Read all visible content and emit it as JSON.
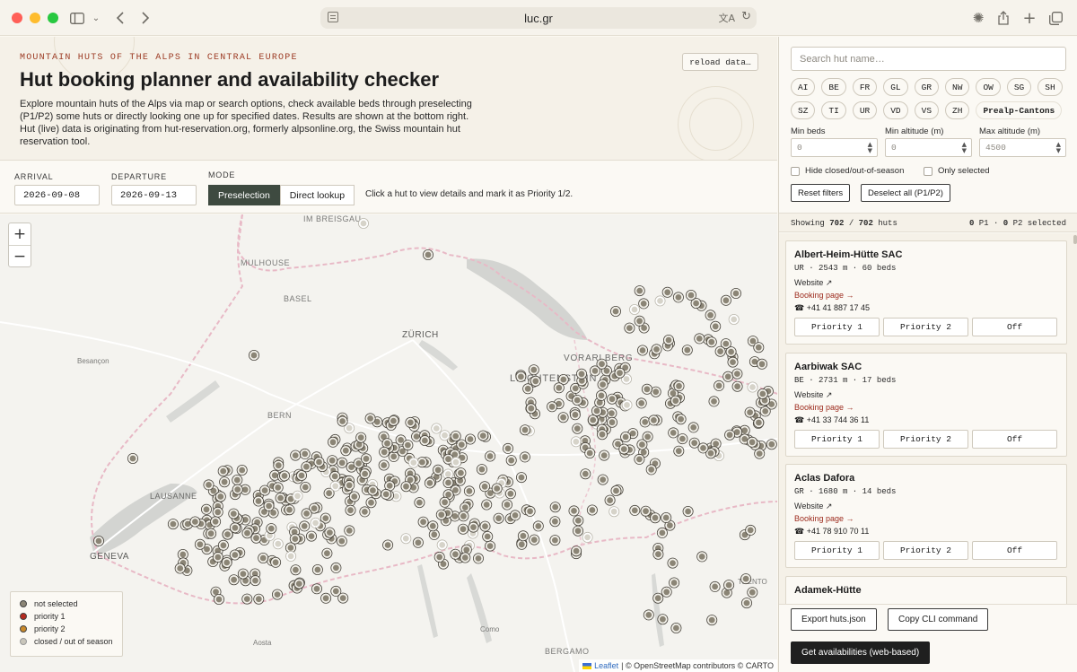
{
  "browser": {
    "url": "luc.gr",
    "icons": [
      "sidebar-toggle-icon",
      "chevron-down-icon",
      "back-icon",
      "forward-icon",
      "page-settings-icon",
      "translate-icon",
      "reload-icon",
      "extensions-icon",
      "share-icon",
      "new-tab-icon",
      "tab-overview-icon"
    ]
  },
  "header": {
    "kicker": "MOUNTAIN HUTS OF THE ALPS IN CENTRAL EUROPE",
    "title": "Hut booking planner and availability checker",
    "description": "Explore mountain huts of the Alps via map or search options, check available beds through preselecting (P1/P2) some huts or directly looking one up for specified dates. Results are shown at the bottom right. Hut (live) data is originating from hut-reservation.org, formerly alpsonline.org, the Swiss mountain hut reservation tool.",
    "reload_label": "reload data…"
  },
  "controls": {
    "arrival_label": "ARRIVAL",
    "arrival_value": "2026-09-08",
    "departure_label": "DEPARTURE",
    "departure_value": "2026-09-13",
    "mode_label": "MODE",
    "mode_preselection": "Preselection",
    "mode_direct": "Direct lookup",
    "hint": "Click a hut to view details and mark it as Priority 1/2."
  },
  "map": {
    "zoom_in": "+",
    "zoom_out": "−",
    "places": [
      "IM BREISGAU",
      "MULHOUSE",
      "BASEL",
      "ZÜRICH",
      "Besançon",
      "VORARLBERG",
      "LIECHTENSTEIN",
      "BERN",
      "LAUSANNE",
      "GENEVA",
      "Aosta",
      "Como",
      "BERGAMO",
      "TRENTO"
    ],
    "legend": [
      {
        "label": "not selected",
        "color": "#8b8576"
      },
      {
        "label": "priority 1",
        "color": "#b52a1f"
      },
      {
        "label": "priority 2",
        "color": "#c9892a"
      },
      {
        "label": "closed / out of season",
        "color": "#c9c6bb"
      }
    ],
    "attribution_leaflet": "Leaflet",
    "attribution_rest": "| © OpenStreetMap contributors © CARTO"
  },
  "sidebar": {
    "search_placeholder": "Search hut name…",
    "cantons": [
      "AI",
      "BE",
      "FR",
      "GL",
      "GR",
      "NW",
      "OW",
      "SG",
      "SH",
      "SZ",
      "TI",
      "UR",
      "VD",
      "VS",
      "ZH",
      "Prealp-Cantons"
    ],
    "min_beds_label": "Min beds",
    "min_beds_value": "0",
    "min_alt_label": "Min altitude (m)",
    "min_alt_value": "0",
    "max_alt_label": "Max altitude (m)",
    "max_alt_value": "4500",
    "hide_closed_label": "Hide closed/out-of-season",
    "only_selected_label": "Only selected",
    "reset_label": "Reset filters",
    "deselect_label": "Deselect all (P1/P2)",
    "showing_prefix": "Showing",
    "showing_count": "702",
    "showing_sep": "/",
    "showing_total": "702",
    "showing_suffix": "huts",
    "p1_count": "0",
    "p1_label": "P1 ·",
    "p2_count": "0",
    "p2_label": "P2 selected",
    "huts": [
      {
        "name": "Albert-Heim-Hütte SAC",
        "meta": "UR · 2543 m · 60 beds",
        "website": "Website ↗",
        "booking": "Booking page →",
        "phone": "☎ +41 41 887 17 45"
      },
      {
        "name": "Aarbiwak SAC",
        "meta": "BE · 2731 m · 17 beds",
        "website": "Website ↗",
        "booking": "Booking page →",
        "phone": "☎ +41 33 744 36 11"
      },
      {
        "name": "Aclas Dafora",
        "meta": "GR · 1680 m · 14 beds",
        "website": "Website ↗",
        "booking": "Booking page →",
        "phone": "☎ +41 78 910 70 11"
      },
      {
        "name": "Adamek-Hütte"
      }
    ],
    "prio1_label": "Priority 1",
    "prio2_label": "Priority 2",
    "off_label": "Off",
    "export_label": "Export huts.json",
    "copy_cli_label": "Copy CLI command",
    "get_avail_label": "Get availabilities (web-based)"
  }
}
